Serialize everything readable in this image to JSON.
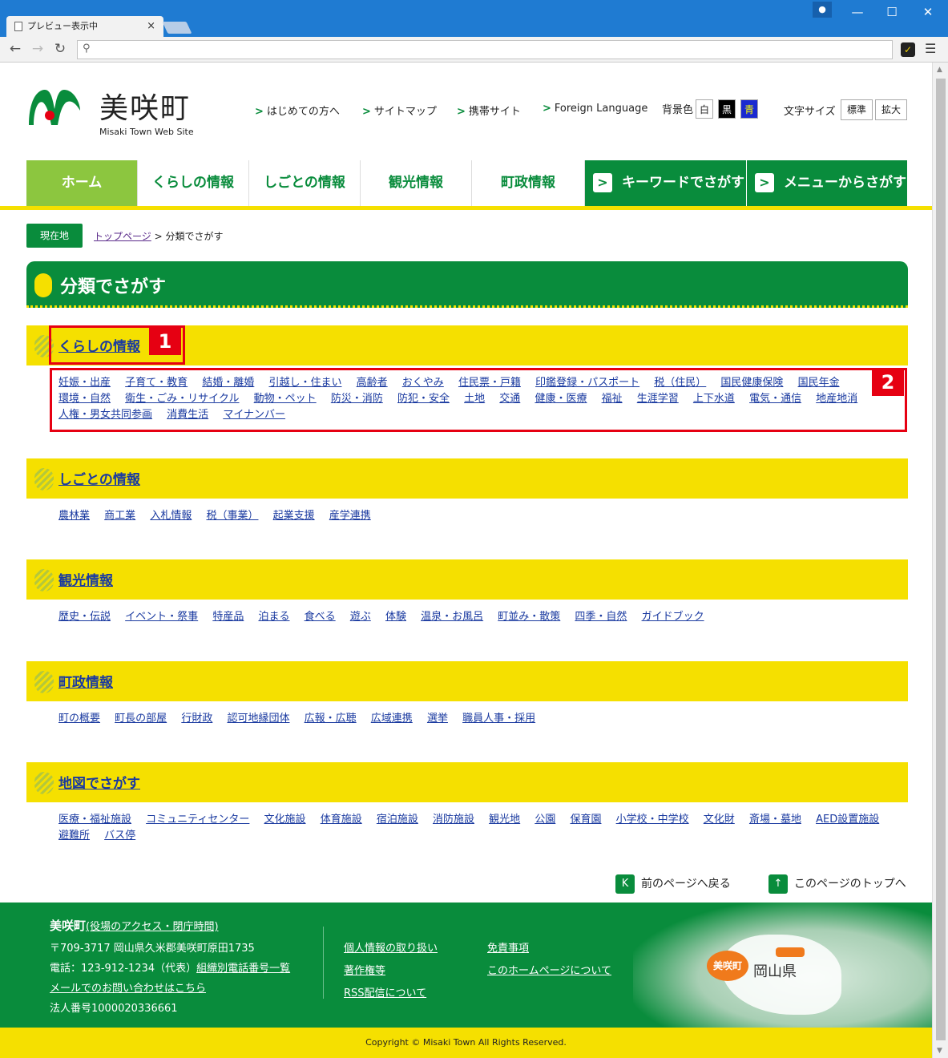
{
  "browser": {
    "tab_title": "プレビュー表示中",
    "tab_close": "×",
    "url": "",
    "minimize": "—",
    "maximize": "☐",
    "close": "✕"
  },
  "header": {
    "site_name": "美咲町",
    "site_sub": "Misaki Town Web Site",
    "util_links": [
      "はじめての方へ",
      "サイトマップ",
      "携帯サイト",
      "Foreign Language"
    ],
    "bg_label": "背景色",
    "bg_options": [
      "白",
      "黒",
      "青"
    ],
    "size_label": "文字サイズ",
    "size_options": [
      "標準",
      "拡大"
    ]
  },
  "gnav": {
    "items": [
      "ホーム",
      "くらしの情報",
      "しごとの情報",
      "観光情報",
      "町政情報"
    ],
    "keyword": "キーワードでさがす",
    "menu": "メニューからさがす"
  },
  "breadcrumb": {
    "label": "現在地",
    "top": "トップページ",
    "sep": ">",
    "current": "分類でさがす"
  },
  "page_title": "分類でさがす",
  "sections": [
    {
      "title": "くらしの情報",
      "links": [
        "妊娠・出産",
        "子育て・教育",
        "結婚・離婚",
        "引越し・住まい",
        "高齢者",
        "おくやみ",
        "住民票・戸籍",
        "印鑑登録・パスポート",
        "税（住民）",
        "国民健康保険",
        "国民年金",
        "環境・自然",
        "衛生・ごみ・リサイクル",
        "動物・ペット",
        "防災・消防",
        "防犯・安全",
        "土地",
        "交通",
        "健康・医療",
        "福祉",
        "生涯学習",
        "上下水道",
        "電気・通信",
        "地産地消",
        "人権・男女共同参画",
        "消費生活",
        "マイナンバー"
      ]
    },
    {
      "title": "しごとの情報",
      "links": [
        "農林業",
        "商工業",
        "入札情報",
        "税（事業）",
        "起業支援",
        "産学連携"
      ]
    },
    {
      "title": "観光情報",
      "links": [
        "歴史・伝説",
        "イベント・祭事",
        "特産品",
        "泊まる",
        "食べる",
        "遊ぶ",
        "体験",
        "温泉・お風呂",
        "町並み・散策",
        "四季・自然",
        "ガイドブック"
      ]
    },
    {
      "title": "町政情報",
      "links": [
        "町の概要",
        "町長の部屋",
        "行財政",
        "認可地縁団体",
        "広報・広聴",
        "広域連携",
        "選挙",
        "職員人事・採用"
      ]
    },
    {
      "title": "地図でさがす",
      "links": [
        "医療・福祉施設",
        "コミュニティセンター",
        "文化施設",
        "体育施設",
        "宿泊施設",
        "消防施設",
        "観光地",
        "公園",
        "保育園",
        "小学校・中学校",
        "文化財",
        "斎場・墓地",
        "AED設置施設",
        "避難所",
        "バス停"
      ]
    }
  ],
  "annotations": [
    "1",
    "2"
  ],
  "pagenav": {
    "back": "前のページへ戻る",
    "top": "このページのトップへ"
  },
  "footer": {
    "name": "美咲町",
    "access": "(役場のアクセス・閉庁時間)",
    "address": "〒709-3717 岡山県久米郡美咲町原田1735",
    "phone": "電話：123-912-1234（代表）",
    "phone_link": "組織別電話番号一覧",
    "mail": "メールでのお問い合わせはこちら",
    "corp_no": "法人番号1000020336661",
    "links_a": [
      "個人情報の取り扱い",
      "著作権等",
      "RSS配信について"
    ],
    "links_b": [
      "免責事項",
      "このホームページについて"
    ],
    "map_town": "美咲町",
    "map_pref": "岡山県"
  },
  "copyright": "Copyright © Misaki Town All Rights Reserved.",
  "colors": {
    "green": "#098c3c",
    "light_green": "#8cc63f",
    "yellow": "#f5e000",
    "annotation_red": "#e60012"
  }
}
